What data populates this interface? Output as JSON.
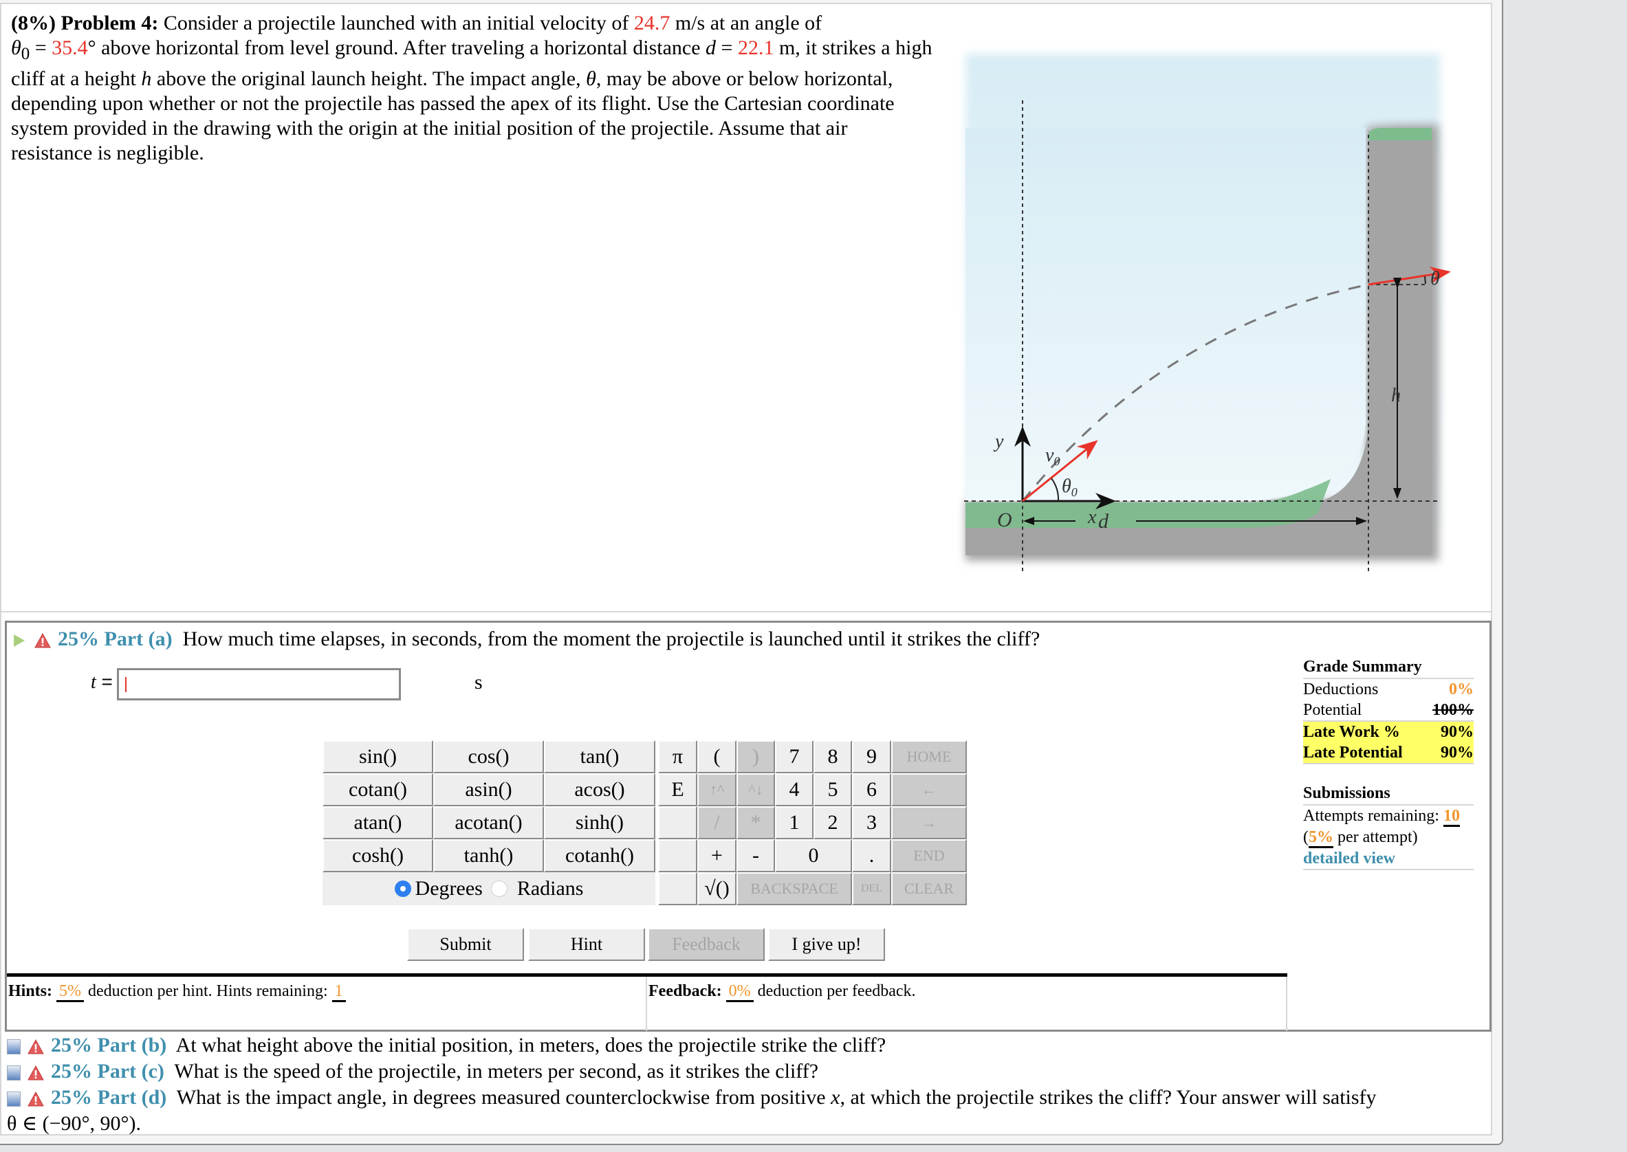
{
  "problem": {
    "weight": "(8%)",
    "label": "Problem 4:",
    "text_1": " Consider a projectile launched with an initial velocity of ",
    "v0": "24.7",
    "text_2": " m/s at an angle of",
    "theta0_sym": "θ",
    "theta0_sub": "0",
    "eq": " = ",
    "theta0": "35.4",
    "deg": "°",
    "text_3": " above horizontal from level ground. After traveling a horizontal distance ",
    "d_sym": "d",
    "d": "22.1",
    "text_4": " m, it strikes a high cliff at a height ",
    "h_sym": "h",
    "text_5": " above the original launch height. The impact angle, ",
    "theta_sym": "θ",
    "text_6": ", may be above or below horizontal, depending upon whether or not the projectile has passed the apex of its flight. Use the Cartesian coordinate system provided in the drawing with the origin at the initial position of the projectile. Assume that air resistance is negligible."
  },
  "diagram": {
    "labels": {
      "y": "y",
      "x": "x",
      "origin": "O",
      "v0": "v",
      "v0_sub": "0",
      "theta0": "θ",
      "theta0_sub": "0",
      "theta": "θ",
      "h": "h",
      "d": "d"
    },
    "colors": {
      "sky": "#dbeef6",
      "grass": "#7dbd8d",
      "rock": "#a6a6a6",
      "vector": "#e8332a"
    }
  },
  "part_a": {
    "weight": "25%",
    "label": "Part (a)",
    "question": "How much time elapses, in seconds, from the moment the projectile is launched until it strikes the cliff?",
    "var": "t",
    "eq": " = ",
    "input_value": "",
    "unit": "s"
  },
  "keypad": {
    "functions": [
      [
        "sin()",
        "cos()",
        "tan()"
      ],
      [
        "cotan()",
        "asin()",
        "acos()"
      ],
      [
        "atan()",
        "acotan()",
        "sinh()"
      ],
      [
        "cosh()",
        "tanh()",
        "cotanh()"
      ]
    ],
    "mode": {
      "degrees": "Degrees",
      "radians": "Radians",
      "selected": "Degrees"
    },
    "keys": {
      "pi": "π",
      "open": "(",
      "close": ")",
      "k7": "7",
      "k8": "8",
      "k9": "9",
      "home": "HOME",
      "e": "E",
      "up": "↑^",
      "down": "^↓",
      "k4": "4",
      "k5": "5",
      "k6": "6",
      "left": "←",
      "div": "/",
      "mul": "*",
      "k1": "1",
      "k2": "2",
      "k3": "3",
      "right": "→",
      "plus": "+",
      "minus": "-",
      "k0": "0",
      "dot": ".",
      "end": "END",
      "sqrt": "√()",
      "backspace": "BACKSPACE",
      "del": "DEL",
      "clear": "CLEAR"
    }
  },
  "actions": {
    "submit": "Submit",
    "hint": "Hint",
    "feedback": "Feedback",
    "give_up": "I give up!"
  },
  "hints": {
    "label": "Hints:",
    "deduction": "5%",
    "text": " deduction per hint. Hints remaining: ",
    "remaining": "1"
  },
  "feedback": {
    "label": "Feedback:",
    "deduction": "0%",
    "text": " deduction per feedback."
  },
  "grade_summary": {
    "title": "Grade Summary",
    "rows": [
      {
        "label": "Deductions",
        "value": "0%"
      },
      {
        "label": "Potential",
        "value": "100%"
      },
      {
        "label": "Late Work %",
        "value": "90%"
      },
      {
        "label": "Late Potential",
        "value": "90%"
      }
    ]
  },
  "submissions": {
    "title": "Submissions",
    "attempts_text": "Attempts remaining: ",
    "attempts": "10",
    "per_open": "(",
    "per_value": "5%",
    "per_text": " per attempt)",
    "detail_link": "detailed view"
  },
  "other_parts": [
    {
      "weight": "25%",
      "label": "Part (b)",
      "question": "At what height above the initial position, in meters, does the projectile strike the cliff?"
    },
    {
      "weight": "25%",
      "label": "Part (c)",
      "question": "What is the speed of the projectile, in meters per second, as it strikes the cliff?"
    },
    {
      "weight": "25%",
      "label": "Part (d)",
      "question": "What is the impact angle, in degrees measured counterclockwise from positive ",
      "var": "x",
      "question_2": ", at which the projectile strikes the cliff? Your answer will satisfy",
      "range": "θ ∈ (−90°, 90°)."
    }
  ]
}
